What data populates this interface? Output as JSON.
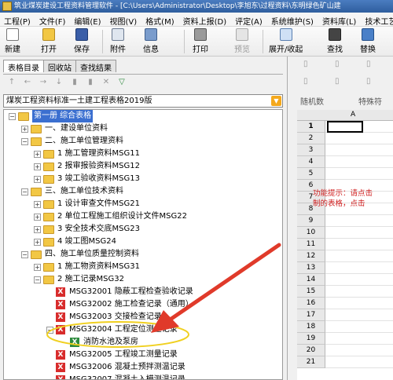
{
  "title": "筑业煤炭建设工程资料管理软件 - [C:\\Users\\Administrator\\Desktop\\李旭东\\过程资料\\东明绿色矿山建",
  "menu": [
    "工程(P)",
    "文件(F)",
    "编辑(E)",
    "视图(V)",
    "格式(M)",
    "资料上报(D)",
    "评定(A)",
    "系统维护(S)",
    "资料库(L)",
    "技术工艺(J"
  ],
  "toolbar": {
    "new": "新建",
    "open": "打开",
    "save": "保存",
    "attach": "附件",
    "info": "信息",
    "print": "打印",
    "preview": "预览",
    "expand": "展开/收起",
    "find": "查找",
    "replace": "替换"
  },
  "left": {
    "tabs": [
      "表格目录",
      "回收站",
      "查找结果"
    ],
    "standard": "煤炭工程资料标准一土建工程表格2019版"
  },
  "tree": {
    "book": "第一册 综合表格",
    "n1": "一、建设单位资料",
    "n2": "二、施工单位管理资料",
    "n2_1": "1 施工管理资料MSG11",
    "n2_2": "2 报审报验资料MSG12",
    "n2_3": "3 竣工验收资料MSG13",
    "n3": "三、施工单位技术资料",
    "n3_1": "1 设计审查文件MSG21",
    "n3_2": "2 单位工程施工组织设计文件MSG22",
    "n3_3": "3 安全技术交底MSG23",
    "n3_4": "4 竣工图MSG24",
    "n4": "四、施工单位质量控制资料",
    "n4_1": "1 施工物资资料MSG31",
    "n4_2": "2 施工记录MSG32",
    "t1": "MSG32001 隐蔽工程检查验收记录",
    "t2": "MSG32002 施工检查记录（通用）",
    "t3": "MSG32003 交接检查记录",
    "t4": "MSG32004 工程定位测量记录",
    "t4_child": "消防水池及泵房",
    "t5": "MSG32005 工程竣工测量记录",
    "t6": "MSG32006 混凝土预拌测温记录",
    "t7": "MSG32007 混凝土入模测温记录",
    "t8": "MSG32008 混凝土养护测温记录"
  },
  "right": {
    "btn_random": "随机数",
    "btn_special": "特殊符",
    "col_a": "A",
    "rows": [
      "1",
      "2",
      "3",
      "4",
      "5",
      "6",
      "7",
      "8",
      "9",
      "10",
      "11",
      "12",
      "13",
      "14",
      "15",
      "16",
      "17",
      "18",
      "19",
      "20",
      "21"
    ],
    "hint1": "功能提示：请点击",
    "hint2": "制的表格，点击"
  },
  "colors": {
    "accent": "#3b6fd0",
    "arrow": "#e03a2a",
    "highlight_ellipse": "#f0d020"
  }
}
